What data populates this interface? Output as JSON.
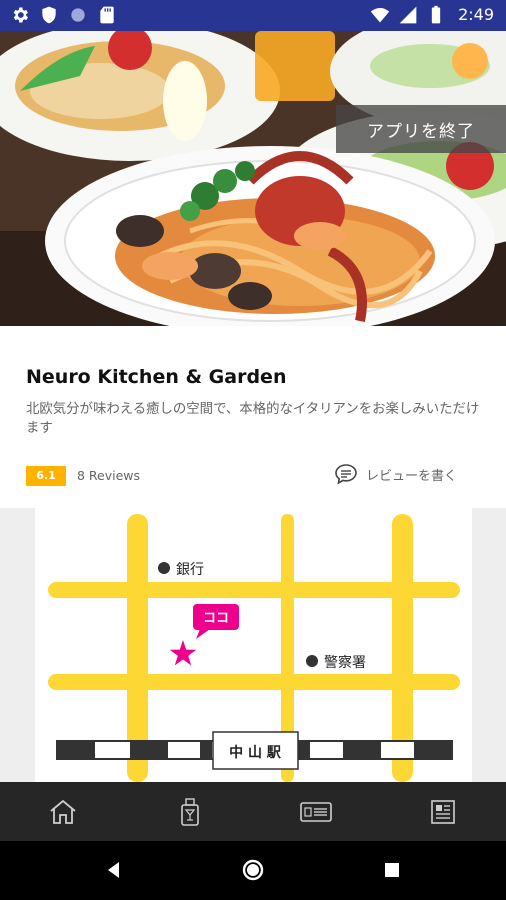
{
  "status_bar": {
    "time": "2:49",
    "left_icons": [
      "gear-icon",
      "shield-icon",
      "circle-icon",
      "sd-card-icon"
    ],
    "right_icons": [
      "wifi-icon",
      "signal-icon",
      "battery-icon"
    ]
  },
  "hero": {
    "exit_button_label": "アプリを終了"
  },
  "restaurant": {
    "name": "Neuro Kitchen & Garden",
    "description": "北欧気分が味わえる癒しの空間で、本格的なイタリアンをお楽しみいただけます",
    "rating": "6.1",
    "reviews": "8 Reviews",
    "write_review_label": "レビューを書く"
  },
  "map": {
    "bank_label": "銀行",
    "police_label": "警察署",
    "here_label": "ココ",
    "station_label": "中 山 駅",
    "road_color": "#fdd835",
    "marker_color": "#ec008c"
  },
  "bottom_nav": {
    "items": [
      "home-icon",
      "drink-menu-icon",
      "card-icon",
      "news-icon"
    ]
  },
  "system_nav": {
    "buttons": [
      "back-icon",
      "home-circle-icon",
      "recents-icon"
    ]
  }
}
